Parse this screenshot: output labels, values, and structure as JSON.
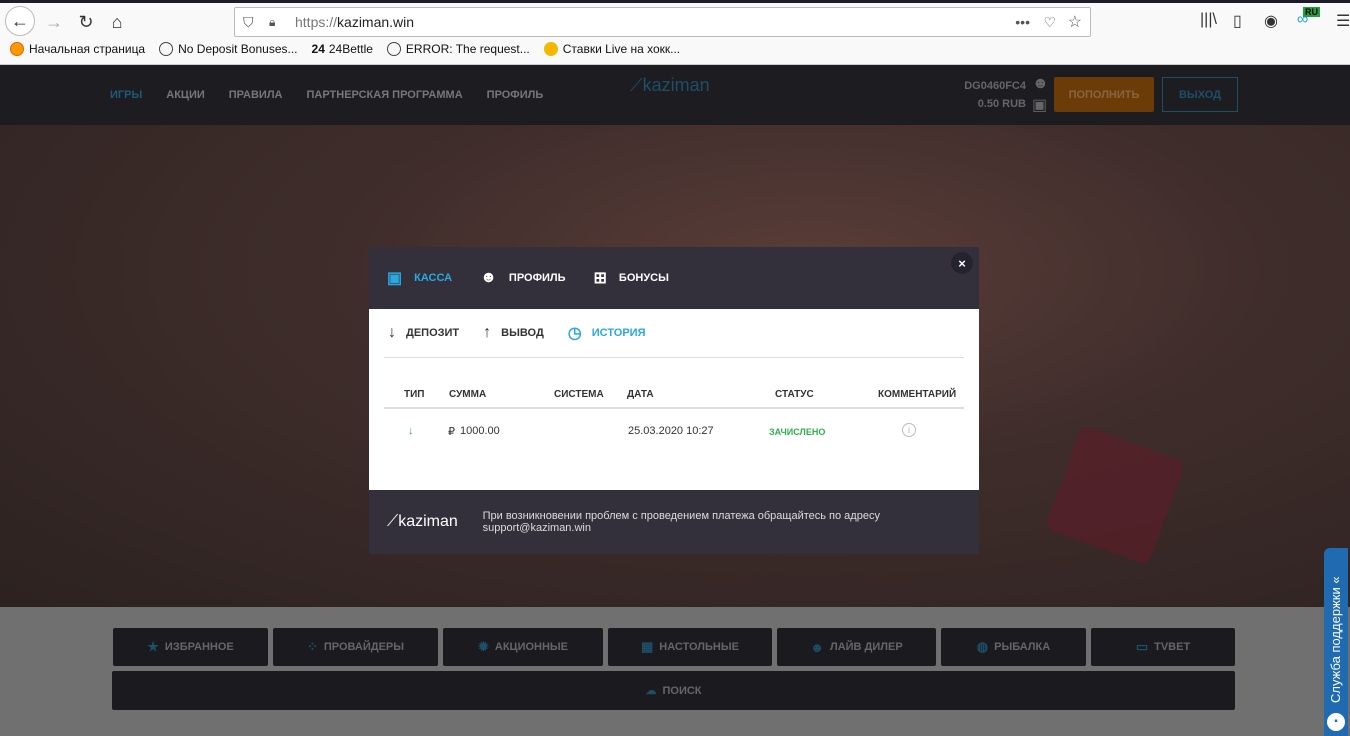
{
  "browser": {
    "url_prefix": "https://",
    "url_host": "kaziman.win",
    "badge": "RU",
    "bookmarks": [
      "Начальная страница",
      "No Deposit Bonuses...",
      "24Bettle",
      "ERROR: The request...",
      "Ставки Live на хокк..."
    ]
  },
  "header": {
    "menu": [
      "ИГРЫ",
      "АКЦИИ",
      "ПРАВИЛА",
      "ПАРТНЕРСКАЯ ПРОГРАММА",
      "ПРОФИЛЬ"
    ],
    "logo": "kaziman",
    "user_id": "DG0460FC4",
    "balance": "0.50 RUB",
    "deposit_label": "ПОПОЛНИТЬ",
    "exit_label": "ВЫХОД"
  },
  "modal": {
    "tabs": [
      "КАССА",
      "ПРОФИЛЬ",
      "БОНУСЫ"
    ],
    "close": "×",
    "subtabs": [
      "ДЕПОЗИТ",
      "ВЫВОД",
      "ИСТОРИЯ"
    ],
    "columns": [
      "ТИП",
      "СУММА",
      "СИСТЕМА",
      "ДАТА",
      "СТАТУС",
      "КОММЕНТАРИЙ"
    ],
    "rows": [
      {
        "type": "↓",
        "currency": "₽",
        "amount": "1000.00",
        "system": "",
        "date": "25.03.2020 10:27",
        "status": "ЗАЧИСЛЕНО"
      }
    ],
    "footer_logo": "kaziman",
    "footer_text": "При возникновении проблем с проведением платежа обращайтесь по адресу support@kaziman.win"
  },
  "categories": [
    "ИЗБРАННОЕ",
    "ПРОВАЙДЕРЫ",
    "АКЦИОННЫЕ",
    "НАСТОЛЬНЫЕ",
    "ЛАЙВ ДИЛЕР",
    "РЫБАЛКА",
    "TVBET"
  ],
  "search_label": "ПОИСК",
  "support_label": "Служба поддержки «"
}
